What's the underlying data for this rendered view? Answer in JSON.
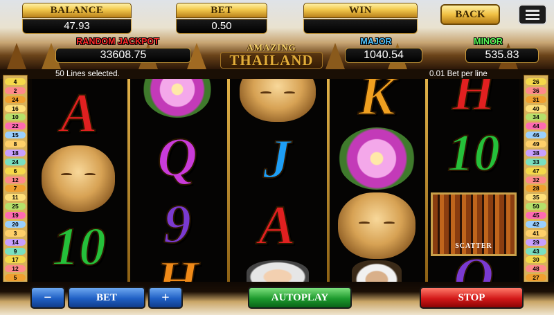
{
  "header": {
    "balance_label": "BALANCE",
    "balance_value": "47.93",
    "bet_label": "BET",
    "bet_value": "0.50",
    "win_label": "WIN",
    "win_value": "",
    "back_label": "BACK",
    "menu_icon": "menu-icon"
  },
  "jackpots": {
    "random_label": "RANDOM JACKPOT",
    "random_value": "33608.75",
    "major_label": "MAJOR",
    "major_value": "1040.54",
    "minor_label": "MINOR",
    "minor_value": "535.83"
  },
  "logo": {
    "line1": "AMAZING",
    "line2": "THAILAND"
  },
  "info": {
    "lines_selected": "50 Lines selected.",
    "bet_per_line": "0.01 Bet per line"
  },
  "paylines_left": [
    "4",
    "2",
    "24",
    "16",
    "10",
    "22",
    "15",
    "8",
    "18",
    "24",
    "6",
    "12",
    "7",
    "11",
    "25",
    "19",
    "20",
    "3",
    "14",
    "9",
    "17",
    "12",
    "5"
  ],
  "paylines_right": [
    "26",
    "36",
    "31",
    "40",
    "34",
    "44",
    "46",
    "49",
    "38",
    "33",
    "47",
    "32",
    "28",
    "35",
    "50",
    "45",
    "42",
    "41",
    "29",
    "43",
    "30",
    "48",
    "27"
  ],
  "reels": [
    [
      "A",
      "buddha-face",
      "10"
    ],
    [
      "lotus",
      "Q",
      "9",
      "H"
    ],
    [
      "buddha-face",
      "J",
      "A",
      "woman"
    ],
    [
      "K",
      "lotus",
      "buddha-face",
      "portrait"
    ],
    [
      "H",
      "10",
      "tiger",
      "Q"
    ]
  ],
  "tiger_label": "SCATTER",
  "controls": {
    "minus": "−",
    "bet": "BET",
    "plus": "+",
    "autoplay": "AUTOPLAY",
    "stop": "STOP"
  },
  "colors": {
    "gold": "#f2c84b",
    "random_jackpot": "#ff2a2a",
    "major": "#4fc3ff",
    "minor": "#5aff5a"
  }
}
